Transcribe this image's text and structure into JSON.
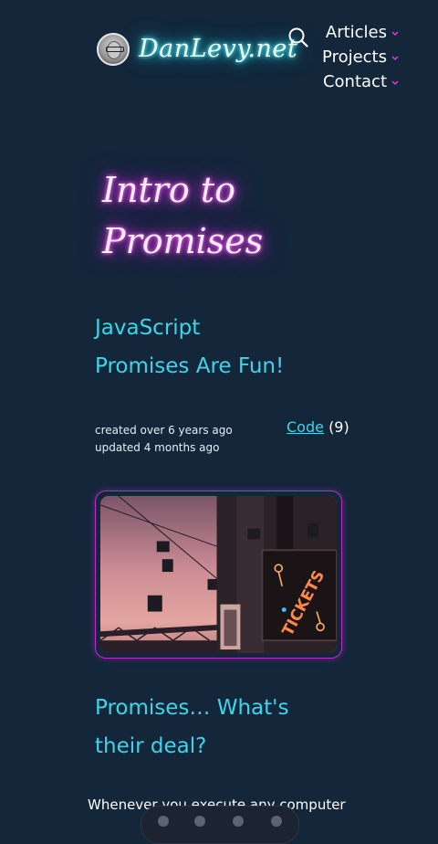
{
  "header": {
    "site_title": "DanLevy.net",
    "nav": [
      {
        "label": "Articles"
      },
      {
        "label": "Projects"
      },
      {
        "label": "Contact"
      }
    ]
  },
  "article": {
    "title_line1": "Intro to",
    "title_line2": "Promises",
    "subtitle_line1": "JavaScript",
    "subtitle_line2": "Promises Are Fun!",
    "created": "created over 6 years ago",
    "updated": "updated 4 months ago",
    "code_link_label": "Code",
    "code_count": "(9)",
    "hero_sign_text": "TICKETS",
    "section_heading_line1": "Promises… What's",
    "section_heading_line2": "their deal?",
    "body_text": "Whenever you execute any computer"
  },
  "colors": {
    "background": "#13263a",
    "accent_cyan": "#3cd6ea",
    "accent_magenta": "#c22acb"
  }
}
